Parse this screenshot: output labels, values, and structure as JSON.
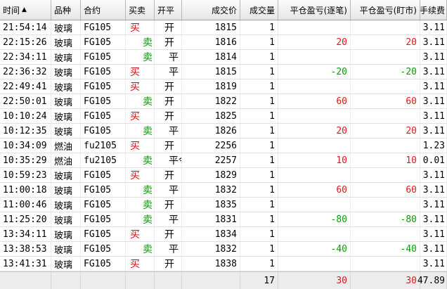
{
  "header": {
    "time": "时间",
    "product": "品种",
    "contract": "合约",
    "buy_sell": "买卖",
    "open_close": "开平",
    "price": "成交价",
    "volume": "成交量",
    "pnl_trade": "平仓盈亏(逐笔)",
    "pnl_mark": "平仓盈亏(盯市)",
    "fee": "手续费"
  },
  "colors": {
    "buy": "#d01010",
    "sell": "#0a9a0a",
    "positive": "#e01818",
    "negative": "#0a9a0a"
  },
  "rows": [
    {
      "time": "21:54:14",
      "product": "玻璃",
      "contract": "FG105",
      "side": "买",
      "oc": "开",
      "price": "1815",
      "vol": "1",
      "pnl_trade": "",
      "pnl_mark": "",
      "fee": "3.11"
    },
    {
      "time": "22:15:26",
      "product": "玻璃",
      "contract": "FG105",
      "side": "卖",
      "oc": "开",
      "price": "1816",
      "vol": "1",
      "pnl_trade": "20",
      "pnl_mark": "20",
      "fee": "3.11"
    },
    {
      "time": "22:34:11",
      "product": "玻璃",
      "contract": "FG105",
      "side": "卖",
      "oc": "平",
      "price": "1814",
      "vol": "1",
      "pnl_trade": "",
      "pnl_mark": "",
      "fee": "3.11"
    },
    {
      "time": "22:36:32",
      "product": "玻璃",
      "contract": "FG105",
      "side": "买",
      "oc": "平",
      "price": "1815",
      "vol": "1",
      "pnl_trade": "-20",
      "pnl_mark": "-20",
      "fee": "3.11"
    },
    {
      "time": "22:49:41",
      "product": "玻璃",
      "contract": "FG105",
      "side": "买",
      "oc": "开",
      "price": "1819",
      "vol": "1",
      "pnl_trade": "",
      "pnl_mark": "",
      "fee": "3.11"
    },
    {
      "time": "22:50:01",
      "product": "玻璃",
      "contract": "FG105",
      "side": "卖",
      "oc": "开",
      "price": "1822",
      "vol": "1",
      "pnl_trade": "60",
      "pnl_mark": "60",
      "fee": "3.11"
    },
    {
      "time": "10:10:24",
      "product": "玻璃",
      "contract": "FG105",
      "side": "买",
      "oc": "开",
      "price": "1825",
      "vol": "1",
      "pnl_trade": "",
      "pnl_mark": "",
      "fee": "3.11"
    },
    {
      "time": "10:12:35",
      "product": "玻璃",
      "contract": "FG105",
      "side": "卖",
      "oc": "平",
      "price": "1826",
      "vol": "1",
      "pnl_trade": "20",
      "pnl_mark": "20",
      "fee": "3.11"
    },
    {
      "time": "10:34:09",
      "product": "燃油",
      "contract": "fu2105",
      "side": "买",
      "oc": "开",
      "price": "2256",
      "vol": "1",
      "pnl_trade": "",
      "pnl_mark": "",
      "fee": "1.23"
    },
    {
      "time": "10:35:29",
      "product": "燃油",
      "contract": "fu2105",
      "side": "卖",
      "oc": "平今",
      "price": "2257",
      "vol": "1",
      "pnl_trade": "10",
      "pnl_mark": "10",
      "fee": "0.01"
    },
    {
      "time": "10:59:23",
      "product": "玻璃",
      "contract": "FG105",
      "side": "买",
      "oc": "开",
      "price": "1829",
      "vol": "1",
      "pnl_trade": "",
      "pnl_mark": "",
      "fee": "3.11"
    },
    {
      "time": "11:00:18",
      "product": "玻璃",
      "contract": "FG105",
      "side": "卖",
      "oc": "平",
      "price": "1832",
      "vol": "1",
      "pnl_trade": "60",
      "pnl_mark": "60",
      "fee": "3.11"
    },
    {
      "time": "11:00:46",
      "product": "玻璃",
      "contract": "FG105",
      "side": "卖",
      "oc": "开",
      "price": "1835",
      "vol": "1",
      "pnl_trade": "",
      "pnl_mark": "",
      "fee": "3.11"
    },
    {
      "time": "11:25:20",
      "product": "玻璃",
      "contract": "FG105",
      "side": "卖",
      "oc": "平",
      "price": "1831",
      "vol": "1",
      "pnl_trade": "-80",
      "pnl_mark": "-80",
      "fee": "3.11"
    },
    {
      "time": "13:34:11",
      "product": "玻璃",
      "contract": "FG105",
      "side": "买",
      "oc": "开",
      "price": "1834",
      "vol": "1",
      "pnl_trade": "",
      "pnl_mark": "",
      "fee": "3.11"
    },
    {
      "time": "13:38:53",
      "product": "玻璃",
      "contract": "FG105",
      "side": "卖",
      "oc": "平",
      "price": "1832",
      "vol": "1",
      "pnl_trade": "-40",
      "pnl_mark": "-40",
      "fee": "3.11"
    },
    {
      "time": "13:41:31",
      "product": "玻璃",
      "contract": "FG105",
      "side": "买",
      "oc": "开",
      "price": "1838",
      "vol": "1",
      "pnl_trade": "",
      "pnl_mark": "",
      "fee": "3.11"
    }
  ],
  "totals": {
    "vol": "17",
    "pnl_trade": "30",
    "pnl_mark": "30",
    "fee": "47.89"
  }
}
